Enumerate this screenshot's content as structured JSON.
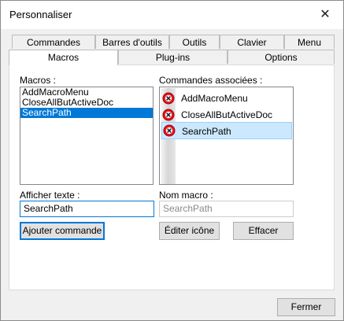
{
  "window": {
    "title": "Personnaliser"
  },
  "tabs_back": [
    "Commandes",
    "Barres d'outils",
    "Outils",
    "Clavier",
    "Menu"
  ],
  "tabs_front": [
    "Macros",
    "Plug-ins",
    "Options"
  ],
  "macros": {
    "label": "Macros :",
    "items": [
      "AddMacroMenu",
      "CloseAllButActiveDoc",
      "SearchPath"
    ],
    "selected_index": 2
  },
  "commands": {
    "label": "Commandes associées :",
    "items": [
      "AddMacroMenu",
      "CloseAllButActiveDoc",
      "SearchPath"
    ],
    "selected_index": 2,
    "icon": "error-circle-icon",
    "icon_color": "#e81123"
  },
  "display_text": {
    "label": "Afficher texte :",
    "value": "SearchPath"
  },
  "macro_name": {
    "label": "Nom macro :",
    "value": "SearchPath"
  },
  "buttons": {
    "add_command": "Ajouter commande",
    "edit_icon": "Éditer icône",
    "clear": "Effacer",
    "close": "Fermer"
  },
  "accent_color": "#0078d7"
}
